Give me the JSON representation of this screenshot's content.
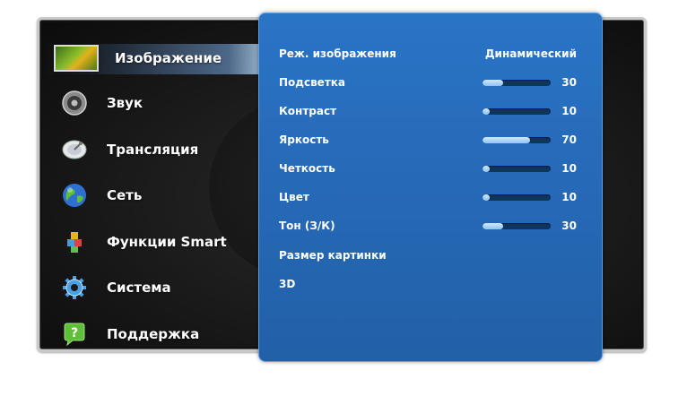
{
  "menu": {
    "items": [
      {
        "label": "Изображение",
        "icon": "picture-icon",
        "active": true
      },
      {
        "label": "Звук",
        "icon": "speaker-icon"
      },
      {
        "label": "Трансляция",
        "icon": "satellite-dish-icon"
      },
      {
        "label": "Сеть",
        "icon": "globe-icon"
      },
      {
        "label": "Функции Smart",
        "icon": "smart-cubes-icon"
      },
      {
        "label": "Система",
        "icon": "gear-icon"
      },
      {
        "label": "Поддержка",
        "icon": "help-question-icon"
      }
    ]
  },
  "panel": {
    "rows": [
      {
        "label": "Реж. изображения",
        "value": "Динамический"
      },
      {
        "label": "Подсветка",
        "value": "30",
        "level": 30
      },
      {
        "label": "Контраст",
        "value": "10",
        "level": 10
      },
      {
        "label": "Яркость",
        "value": "70",
        "level": 70
      },
      {
        "label": "Четкость",
        "value": "10",
        "level": 10
      },
      {
        "label": "Цвет",
        "value": "10",
        "level": 10
      },
      {
        "label": "Тон (З/К)",
        "value": "30",
        "level": 30
      },
      {
        "label": "Размер картинки"
      },
      {
        "label": "3D"
      }
    ]
  },
  "colors": {
    "panel": "#2669b6",
    "slider_track": "#0e3560",
    "slider_fill": "#8fc4f0"
  }
}
